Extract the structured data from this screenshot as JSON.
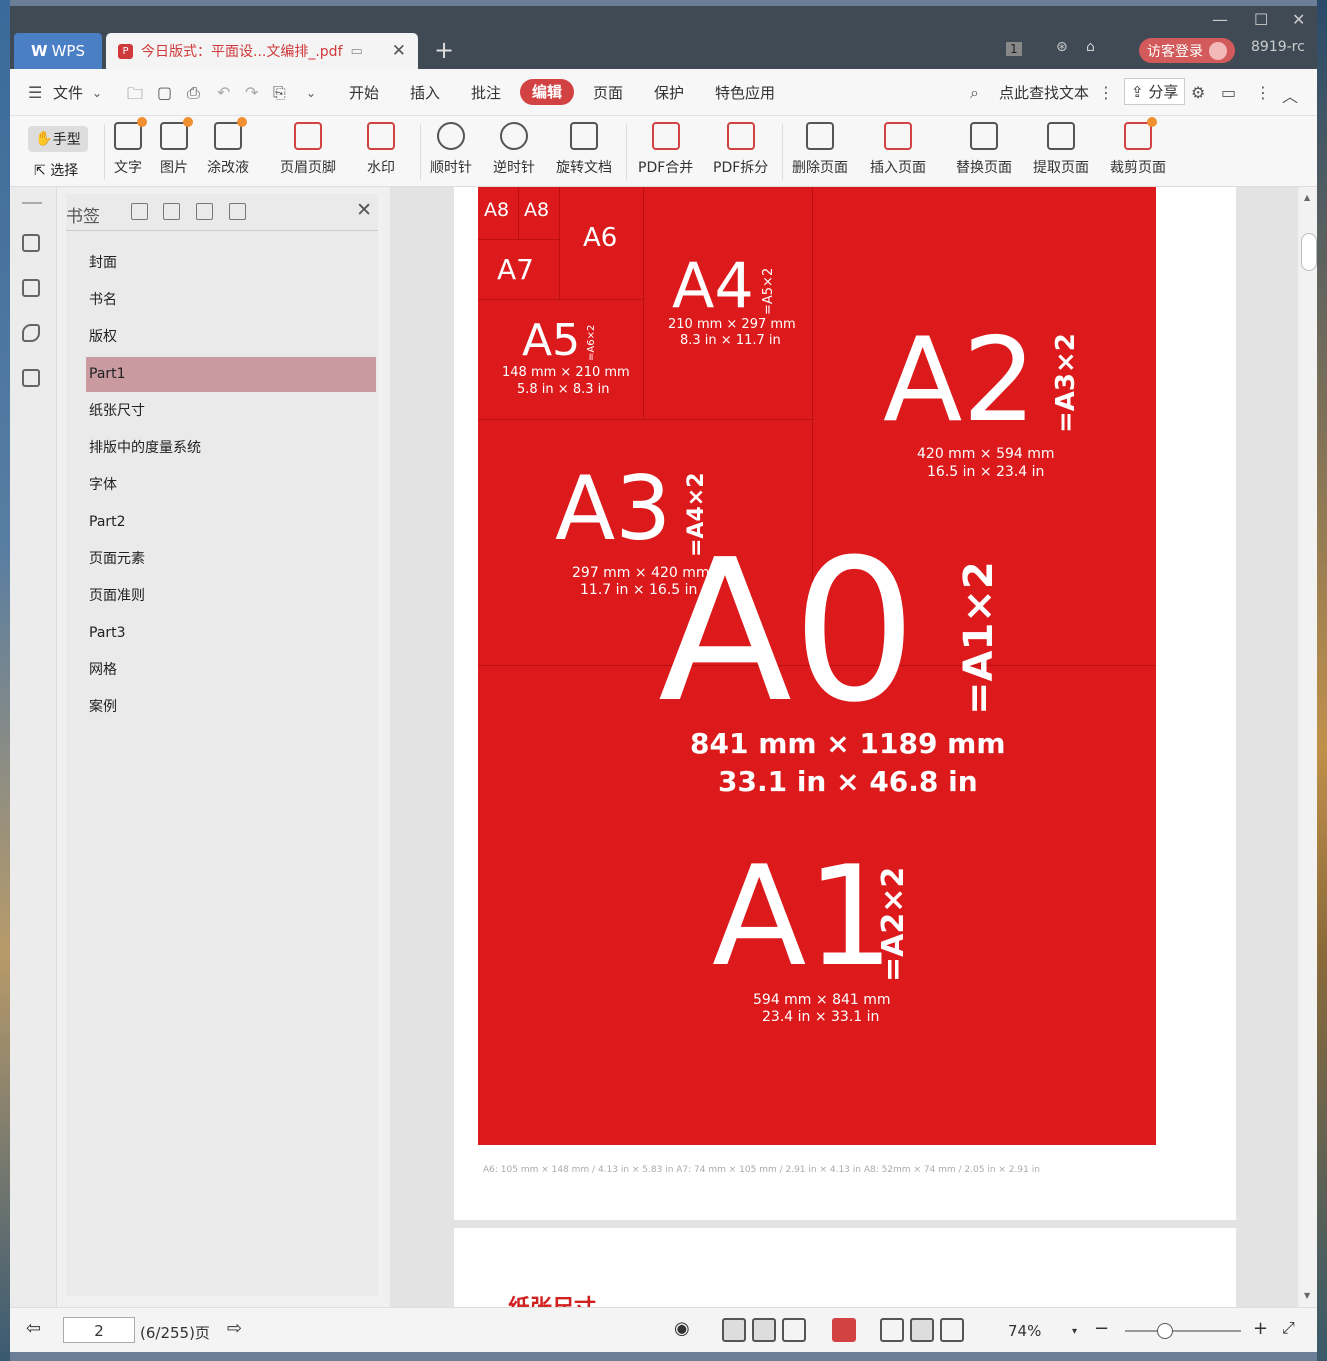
{
  "titlebar": {
    "wps_label": "WPS",
    "doc_tab_title": "今日版式：平面设...文编排_.pdf",
    "user_button": "访客登录",
    "user_id": "8919-rc",
    "page_count_badge": "1"
  },
  "menu": {
    "file": "文件",
    "items": [
      "开始",
      "插入",
      "批注",
      "编辑",
      "页面",
      "保护",
      "特色应用"
    ],
    "active": "编辑",
    "search_placeholder": "点此查找文本",
    "share": "分享"
  },
  "ribbon": {
    "hand": "手型",
    "select": "选择",
    "tools": [
      "文字",
      "图片",
      "涂改液",
      "页眉页脚",
      "水印",
      "顺时针",
      "逆时针",
      "旋转文档",
      "PDF合并",
      "PDF拆分",
      "删除页面",
      "插入页面",
      "替换页面",
      "提取页面",
      "裁剪页面"
    ]
  },
  "bookmarks": {
    "title": "书签",
    "items": [
      "封面",
      "书名",
      "版权",
      "Part1",
      "纸张尺寸",
      "排版中的度量系统",
      "字体",
      "Part2",
      "页面元素",
      "页面准则",
      "Part3",
      "网格",
      "案例"
    ],
    "selected": "Part1"
  },
  "page": {
    "a8a": "A8",
    "a8b": "A8",
    "a6": "A6",
    "a7": "A7",
    "a4": "A4",
    "a4_eq": "=A5×2",
    "a4_mm": "210 mm × 297 mm",
    "a4_in": "8.3 in × 11.7 in",
    "a5": "A5",
    "a5_eq": "=A6×2",
    "a5_mm": "148 mm × 210 mm",
    "a5_in": "5.8 in × 8.3 in",
    "a2": "A2",
    "a2_eq": "=A3×2",
    "a2_mm": "420 mm × 594 mm",
    "a2_in": "16.5 in × 23.4 in",
    "a3": "A3",
    "a3_eq": "=A4×2",
    "a3_mm": "297 mm × 420 mm",
    "a3_in": "11.7 in × 16.5 in",
    "a0": "A0",
    "a0_eq": "=A1×2",
    "a0_mm": "841 mm × 1189 mm",
    "a0_in": "33.1 in × 46.8 in",
    "a1": "A1",
    "a1_eq": "=A2×2",
    "a1_mm": "594 mm × 841 mm",
    "a1_in": "23.4 in × 33.1 in",
    "footnote": "A6: 105 mm × 148 mm / 4.13 in × 5.83 in     A7: 74 mm × 105 mm / 2.91 in × 4.13 in     A8: 52mm × 74 mm / 2.05 in × 2.91 in",
    "next_heading": "纸张尺寸"
  },
  "status": {
    "page_input": "2",
    "page_total": "(6/255)页",
    "zoom": "74%"
  },
  "colors": {
    "accent": "#d24242",
    "page_red": "#dc1a1c"
  }
}
